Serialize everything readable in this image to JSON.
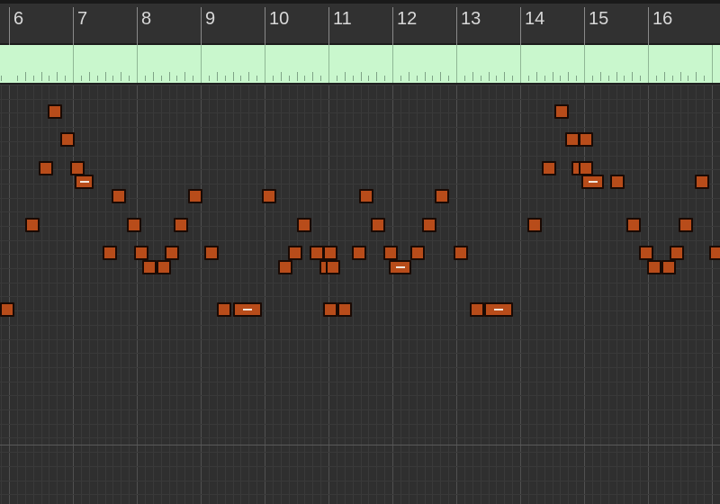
{
  "ruler": {
    "bar_numbers": [
      "6",
      "7",
      "8",
      "9",
      "10",
      "11",
      "12",
      "13",
      "14",
      "15",
      "16"
    ],
    "first_visible_bar": 6,
    "visible_bar_count": 11
  },
  "colors": {
    "background": "#2e2e2e",
    "ruler_background": "#313131",
    "region_strip": "#c9f7cd",
    "note_fill": "#b84c1a",
    "note_border": "#1a0a04",
    "bar_line": "#505050",
    "beat_line": "#3a3a3a"
  },
  "notes": [
    {
      "beat": 0.0,
      "length": 0.2,
      "row": 0
    },
    {
      "beat": 0.4,
      "length": 0.2,
      "row": 3
    },
    {
      "beat": 0.6,
      "length": 0.2,
      "row": 5
    },
    {
      "beat": 0.75,
      "length": 0.2,
      "row": 7
    },
    {
      "beat": 0.95,
      "length": 0.2,
      "row": 6
    },
    {
      "beat": 1.1,
      "length": 0.2,
      "row": 5
    },
    {
      "beat": 1.17,
      "length": 0.3,
      "row": 4.5,
      "dash": true
    },
    {
      "beat": 1.6,
      "length": 0.2,
      "row": 2
    },
    {
      "beat": 1.75,
      "length": 0.2,
      "row": 4
    },
    {
      "beat": 1.98,
      "length": 0.2,
      "row": 3
    },
    {
      "beat": 2.1,
      "length": 0.2,
      "row": 2
    },
    {
      "beat": 2.22,
      "length": 0.2,
      "row": 1.5
    },
    {
      "beat": 2.45,
      "length": 0.2,
      "row": 1.5
    },
    {
      "beat": 2.58,
      "length": 0.2,
      "row": 2
    },
    {
      "beat": 2.72,
      "length": 0.2,
      "row": 3
    },
    {
      "beat": 2.95,
      "length": 0.2,
      "row": 4
    },
    {
      "beat": 3.2,
      "length": 0.2,
      "row": 2
    },
    {
      "beat": 3.4,
      "length": 0.2,
      "row": 0
    },
    {
      "beat": 3.65,
      "length": 0.45,
      "row": 0,
      "dash": true
    },
    {
      "beat": 4.1,
      "length": 0.2,
      "row": 4
    },
    {
      "beat": 4.35,
      "length": 0.2,
      "row": 1.5
    },
    {
      "beat": 4.5,
      "length": 0.2,
      "row": 2
    },
    {
      "beat": 4.65,
      "length": 0.2,
      "row": 3
    },
    {
      "beat": 4.85,
      "length": 0.2,
      "row": 2
    },
    {
      "beat": 5.0,
      "length": 0.2,
      "row": 1.5
    },
    {
      "beat": 5.05,
      "length": 0.2,
      "row": 2
    },
    {
      "beat": 5.1,
      "length": 0.2,
      "row": 1.5
    },
    {
      "beat": 5.05,
      "length": 0.2,
      "row": 0
    },
    {
      "beat": 5.28,
      "length": 0.2,
      "row": 0
    },
    {
      "beat": 5.5,
      "length": 0.2,
      "row": 2
    },
    {
      "beat": 5.62,
      "length": 0.2,
      "row": 4
    },
    {
      "beat": 5.8,
      "length": 0.2,
      "row": 3
    },
    {
      "beat": 6.0,
      "length": 0.2,
      "row": 2
    },
    {
      "beat": 6.08,
      "length": 0.35,
      "row": 1.5,
      "dash": true
    },
    {
      "beat": 6.42,
      "length": 0.2,
      "row": 2
    },
    {
      "beat": 6.6,
      "length": 0.2,
      "row": 3
    },
    {
      "beat": 6.8,
      "length": 0.2,
      "row": 4
    },
    {
      "beat": 7.1,
      "length": 0.2,
      "row": 2
    },
    {
      "beat": 7.35,
      "length": 0.2,
      "row": 0
    },
    {
      "beat": 7.58,
      "length": 0.45,
      "row": 0,
      "dash": true
    },
    {
      "beat": 8.25,
      "length": 0.2,
      "row": 3
    },
    {
      "beat": 8.48,
      "length": 0.2,
      "row": 5
    },
    {
      "beat": 8.68,
      "length": 0.2,
      "row": 7
    },
    {
      "beat": 8.85,
      "length": 0.2,
      "row": 6
    },
    {
      "beat": 9.05,
      "length": 0.2,
      "row": 6
    },
    {
      "beat": 8.95,
      "length": 0.2,
      "row": 5
    },
    {
      "beat": 9.05,
      "length": 0.2,
      "row": 5
    },
    {
      "beat": 9.1,
      "length": 0.35,
      "row": 4.5,
      "dash": true
    },
    {
      "beat": 9.55,
      "length": 0.2,
      "row": 4.5
    },
    {
      "beat": 9.8,
      "length": 0.2,
      "row": 3
    },
    {
      "beat": 10.0,
      "length": 0.2,
      "row": 2
    },
    {
      "beat": 10.12,
      "length": 0.2,
      "row": 1.5
    },
    {
      "beat": 10.35,
      "length": 0.2,
      "row": 1.5
    },
    {
      "beat": 10.48,
      "length": 0.2,
      "row": 2
    },
    {
      "beat": 10.62,
      "length": 0.2,
      "row": 3
    },
    {
      "beat": 10.88,
      "length": 0.2,
      "row": 4.5
    },
    {
      "beat": 11.1,
      "length": 0.2,
      "row": 2
    }
  ]
}
